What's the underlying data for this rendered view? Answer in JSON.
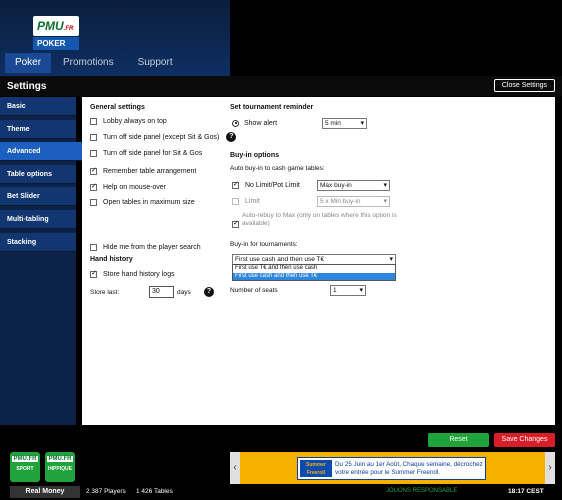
{
  "brand": {
    "name": "PMU",
    "tld": ".FR",
    "product": "POKER"
  },
  "tabs": [
    "Poker",
    "Promotions",
    "Support"
  ],
  "settings": {
    "title": "Settings",
    "close_label": "Close Settings"
  },
  "sidebar": {
    "items": [
      "Basic",
      "Theme",
      "Advanced",
      "Table options",
      "Bet Slider",
      "Multi-tabling",
      "Stacking"
    ],
    "active": "Advanced"
  },
  "general": {
    "title": "General settings",
    "options": [
      {
        "label": "Lobby always on top",
        "checked": false
      },
      {
        "label": "Turn off side panel (except Sit & Gos)",
        "checked": false
      },
      {
        "label": "Turn off side panel for Sit & Gos",
        "checked": false
      },
      {
        "label": "Remember table arrangement",
        "checked": true
      },
      {
        "label": "Help on mouse-over",
        "checked": true
      },
      {
        "label": "Open tables in maximum size",
        "checked": false
      }
    ],
    "hide_me": "Hide me from the player search"
  },
  "hand_history": {
    "title": "Hand history",
    "store_label": "Store hand history logs",
    "store_last_label": "Store last:",
    "store_last_value": "30",
    "days_label": "days"
  },
  "tournament_reminder": {
    "title": "Set tournament reminder",
    "show_alert_label": "Show alert",
    "alert_value": "5 min"
  },
  "buyin": {
    "title": "Buy-in options",
    "auto_label": "Auto buy-in to cash game tables:",
    "nolimit_label": "No Limit/Pot Limit",
    "nolimit_value": "Max buy-in",
    "limit_label": "Limit",
    "limit_value": "5 x Min buy-in",
    "rebuy_label": "Auto-rebuy to Max (only on tables where this option is available)",
    "tournaments_label": "Buy-in for tournaments:",
    "tournaments_value": "First use cash and then use T€",
    "tournaments_options": [
      "First use T€ and then use cash",
      "First use cash and then use T€"
    ],
    "seats_label": "Number of seats",
    "seats_value": "1",
    "help": "?"
  },
  "buttons": {
    "reset": "Reset",
    "save": "Save Changes"
  },
  "sports": [
    {
      "label": "PMU.FR",
      "sub": "SPORT"
    },
    {
      "label": "PMU.FR",
      "sub": "HIPPIQUE"
    }
  ],
  "banner": {
    "badge": "Summer Freeroll",
    "text": "Du 25 Juin au 1er Août, Chaque semaine, décrochez votre entrée pour le Summer Freeroll."
  },
  "status": {
    "real_money": "Real Money",
    "players": "2 387 Players",
    "tables": "1 426 Tables",
    "jouons": "JOUONS RESPONSABLE",
    "clock": "18:17 CEST"
  },
  "colors": {
    "accent": "#1c5fc0",
    "reset": "#1fa33a",
    "save": "#d91e2a",
    "banner": "#f6b100"
  }
}
